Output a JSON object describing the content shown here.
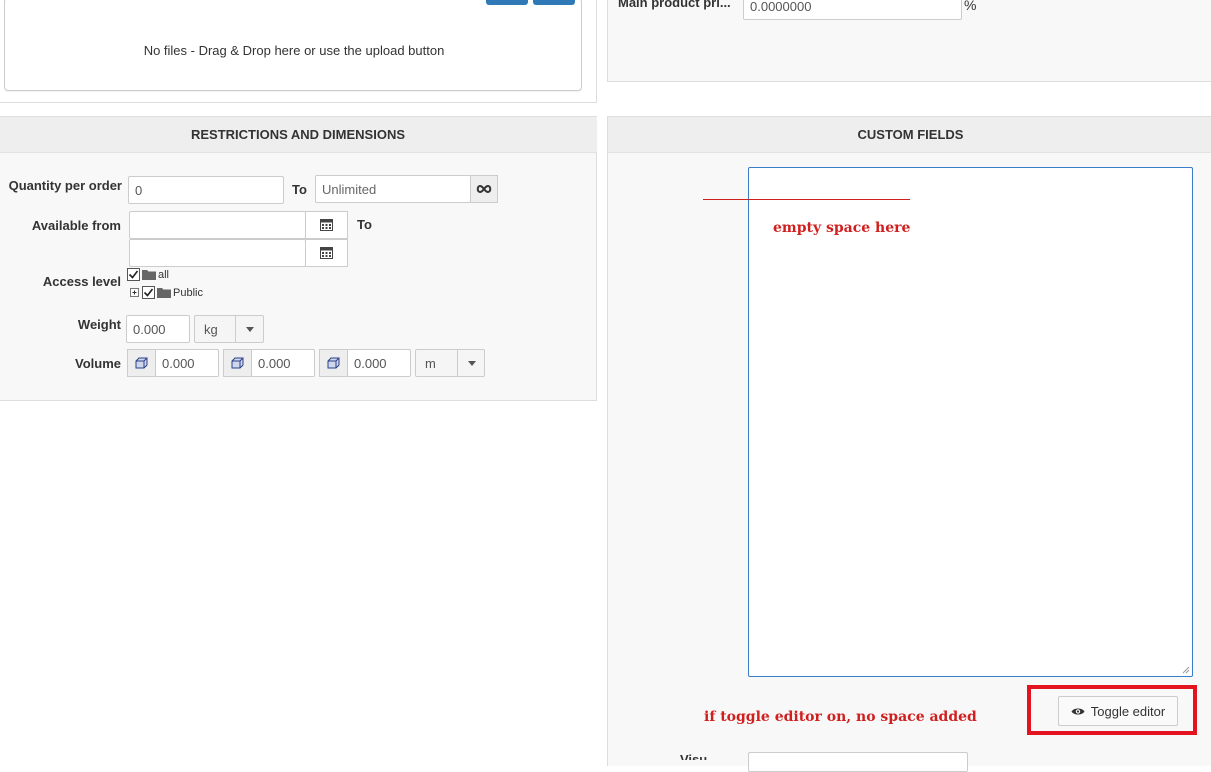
{
  "upload": {
    "empty_text": "No files - Drag & Drop here or use the upload button"
  },
  "pricing": {
    "label": "Main product pri...",
    "value": "0.0000000",
    "unit": "%"
  },
  "restrictions": {
    "title": "RESTRICTIONS AND DIMENSIONS",
    "quantity_label": "Quantity per order",
    "quantity_min": "0",
    "to_label": "To",
    "quantity_max_placeholder": "Unlimited",
    "available_label": "Available from",
    "available_to_label": "To",
    "access_label": "Access level",
    "access_items": [
      "all",
      "Public"
    ],
    "weight_label": "Weight",
    "weight_value": "0.000",
    "weight_unit": "kg",
    "volume_label": "Volume",
    "volume_values": [
      "0.000",
      "0.000",
      "0.000"
    ],
    "volume_unit": "m"
  },
  "custom_fields": {
    "title": "CUSTOM FIELDS",
    "annotation_space": "empty space here",
    "annotation_toggle": "if toggle editor on, no space added",
    "toggle_label": "Toggle editor",
    "next_label": "Visu"
  },
  "colors": {
    "annotation": "#d01f1f",
    "highlight_frame": "#e3141f",
    "upload_button": "#2f79b7"
  }
}
